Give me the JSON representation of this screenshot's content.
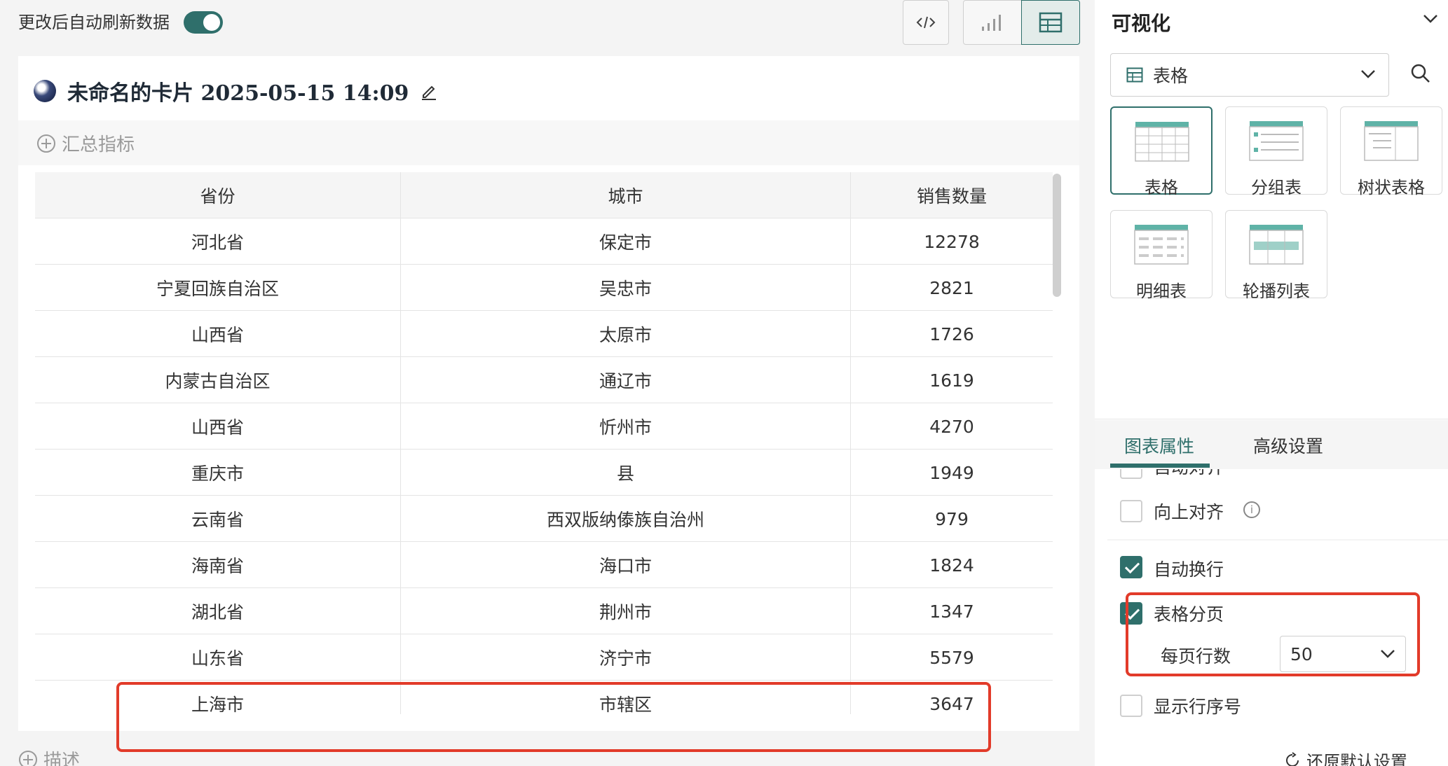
{
  "toolbar": {
    "auto_refresh_label": "更改后自动刷新数据",
    "auto_refresh_on": true
  },
  "card": {
    "title": "未命名的卡片 2025-05-15 14:09",
    "summary_add_label": "汇总指标",
    "description_add_label": "描述"
  },
  "table": {
    "headers": [
      "省份",
      "城市",
      "销售数量"
    ],
    "rows": [
      [
        "河北省",
        "保定市",
        "12278"
      ],
      [
        "宁夏回族自治区",
        "吴忠市",
        "2821"
      ],
      [
        "山西省",
        "太原市",
        "1726"
      ],
      [
        "内蒙古自治区",
        "通辽市",
        "1619"
      ],
      [
        "山西省",
        "忻州市",
        "4270"
      ],
      [
        "重庆市",
        "县",
        "1949"
      ],
      [
        "云南省",
        "西双版纳傣族自治州",
        "979"
      ],
      [
        "海南省",
        "海口市",
        "1824"
      ],
      [
        "湖北省",
        "荆州市",
        "1347"
      ],
      [
        "山东省",
        "济宁市",
        "5579"
      ],
      [
        "上海市",
        "市辖区",
        "3647"
      ]
    ]
  },
  "panel": {
    "section_title": "可视化",
    "selected_viz": "表格",
    "viz_types": [
      "表格",
      "分组表",
      "树状表格",
      "明细表",
      "轮播列表"
    ],
    "tabs": [
      "图表属性",
      "高级设置"
    ],
    "active_tab": "图表属性",
    "props": {
      "clipped_label": "自动对齐",
      "align_top_label": "向上对齐",
      "auto_wrap_label": "自动换行",
      "pagination_label": "表格分页",
      "rows_per_page_label": "每页行数",
      "rows_per_page_value": "50",
      "show_row_number_label": "显示行序号"
    },
    "reset_label": "还原默认设置"
  },
  "colors": {
    "accent": "#2f6f6b",
    "highlight": "#e23b2a"
  }
}
